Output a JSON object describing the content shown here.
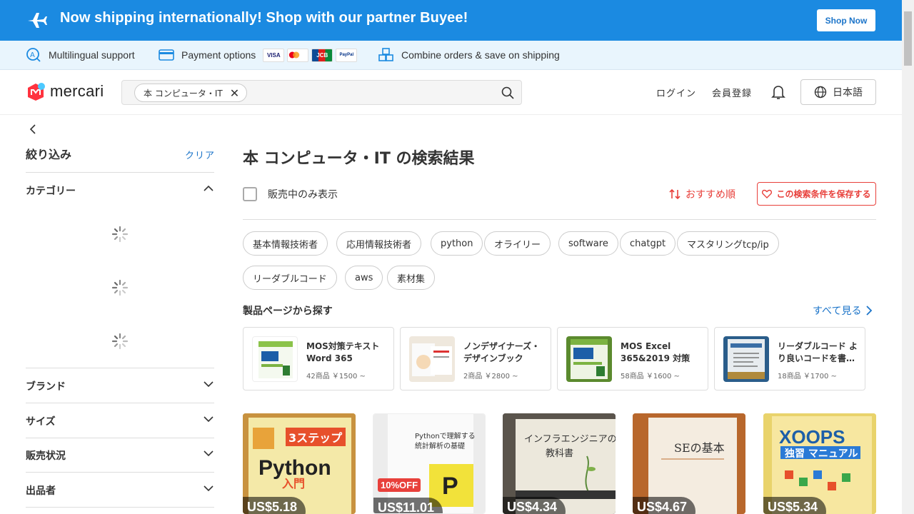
{
  "banner": {
    "message": "Now shipping internationally! Shop with our partner Buyee!",
    "button": "Shop Now"
  },
  "infobar": {
    "multilingual": "Multilingual support",
    "payment": "Payment options",
    "cards": [
      "VISA",
      "MC",
      "JCB",
      "PayPal"
    ],
    "combine": "Combine orders & save on shipping"
  },
  "header": {
    "logo": "mercari",
    "search_chip": "本 コンピュータ・IT",
    "login": "ログイン",
    "register": "会員登録",
    "language": "日本語"
  },
  "sidebar": {
    "title": "絞り込み",
    "clear": "クリア",
    "sections": [
      "カテゴリー",
      "ブランド",
      "サイズ",
      "販売状況",
      "出品者"
    ]
  },
  "main": {
    "title": "本 コンピュータ・IT の検索結果",
    "on_sale_only": "販売中のみ表示",
    "sort": "おすすめ順",
    "save_search": "この検索条件を保存する",
    "tags": [
      "基本情報技術者",
      "応用情報技術者",
      "python",
      "オライリー",
      "software",
      "chatgpt",
      "マスタリングtcp/ip",
      "リーダブルコード",
      "aws",
      "素材集"
    ],
    "products_heading": "製品ページから探す",
    "see_all": "すべて見る",
    "products": [
      {
        "name": "MOS対策テキスト Word 365",
        "info": "42商品 ￥1500 ~"
      },
      {
        "name": "ノンデザイナーズ・デザインブック",
        "info": "2商品 ￥2800 ~"
      },
      {
        "name": "MOS Excel 365&2019 対策テ…",
        "info": "58商品 ￥1600 ~"
      },
      {
        "name": "リーダブルコード より良いコードを書…",
        "info": "18商品 ￥1700 ~"
      }
    ],
    "items": [
      {
        "price": "US$5.18",
        "cover": "3ステップ Python入門"
      },
      {
        "price": "US$11.01",
        "cover": "Pythonで理解する統計解析の基礎",
        "badge": "10%OFF"
      },
      {
        "price": "US$4.34",
        "cover": "インフラエンジニアの教科書"
      },
      {
        "price": "US$4.67",
        "cover": "SEの基本"
      },
      {
        "price": "US$5.34",
        "cover": "XOOPS マニュアル"
      }
    ]
  }
}
